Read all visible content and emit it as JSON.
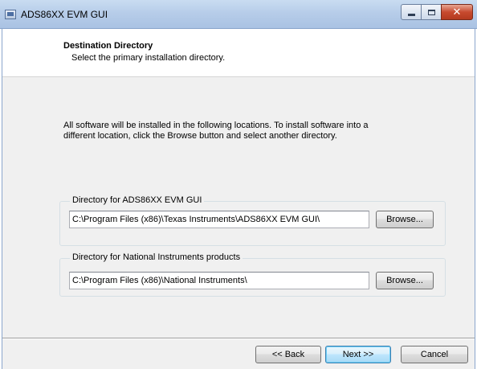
{
  "window": {
    "title": "ADS86XX EVM GUI",
    "buttons": {
      "minimize": "minimize-icon",
      "maximize": "maximize-icon",
      "close": "close-icon"
    }
  },
  "header": {
    "title": "Destination Directory",
    "subtitle": "Select the primary installation directory."
  },
  "intro": "All software will be installed in the following locations. To install software into a different location, click the Browse button and select another directory.",
  "groups": [
    {
      "label": "Directory for ADS86XX EVM GUI",
      "path": "C:\\Program Files (x86)\\Texas Instruments\\ADS86XX EVM GUI\\",
      "browse_label": "Browse..."
    },
    {
      "label": "Directory for National Instruments products",
      "path": "C:\\Program Files (x86)\\National Instruments\\",
      "browse_label": "Browse..."
    }
  ],
  "footer": {
    "back_label": "<< Back",
    "next_label": "Next >>",
    "cancel_label": "Cancel"
  },
  "colors": {
    "titlebar": "#b7cde9",
    "close_button": "#c74a2f",
    "body": "#f0f0f0"
  }
}
